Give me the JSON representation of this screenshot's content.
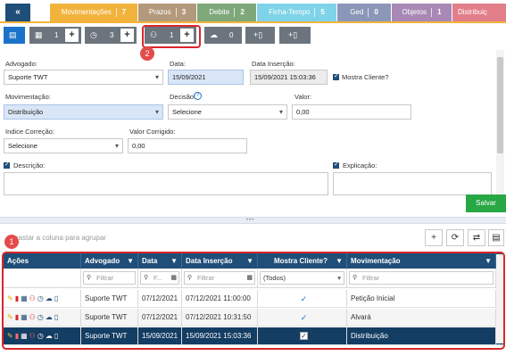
{
  "colors": {
    "accent": "#1f4e79",
    "active_blue": "#1a73c9",
    "save_green": "#28a745",
    "annotation_red": "#d9262c"
  },
  "tabs": [
    {
      "label": "Movimentações",
      "count": "7",
      "color": "#f2b33d"
    },
    {
      "label": "Prazos",
      "count": "3",
      "color": "#b39a7c"
    },
    {
      "label": "Debite",
      "count": "2",
      "color": "#7fa87a"
    },
    {
      "label": "Ficha-Tempo",
      "count": "5",
      "color": "#7fd3e8"
    },
    {
      "label": "Ged",
      "count": "0",
      "color": "#8b97b8"
    },
    {
      "label": "Objetos",
      "count": "1",
      "color": "#a888b5"
    },
    {
      "label": "Distribuiç",
      "count": "",
      "color": "#e37e8b"
    }
  ],
  "toolbar": {
    "calendar_count": "1",
    "clock_count": "3",
    "users_count": "1",
    "cloud_count": "0",
    "plus": "+"
  },
  "callouts": {
    "one": "1",
    "two": "2"
  },
  "form": {
    "advogado_label": "Advogado:",
    "advogado_value": "Suporte TWT",
    "data_label": "Data:",
    "data_value": "15/09/2021",
    "data_insercao_label": "Data Inserção:",
    "data_insercao_value": "15/09/2021 15:03:36",
    "mostra_cliente_label": "Mostra Cliente?",
    "movimentacao_label": "Movimentação:",
    "movimentacao_value": "Distribuição",
    "decisao_label": "Decisão:",
    "decisao_value": "Selecione",
    "valor_label": "Valor:",
    "valor_value": "0,00",
    "indice_label": "Indice Correção:",
    "indice_value": "Selecione",
    "valor_corrigido_label": "Valor Corrigido:",
    "valor_corrigido_value": "0,00",
    "descricao_label": "Descrição:",
    "explicacao_label": "Explicação:",
    "save_label": "Salvar"
  },
  "grid": {
    "group_hint": "Arrastar a coluna para agrupar",
    "columns": [
      "Ações",
      "Advogado",
      "Data",
      "Data Inserção",
      "Mostra Cliente?",
      "Movimentação"
    ],
    "filters": {
      "advogado_placeholder": "Filtrar",
      "data_placeholder": "F...",
      "data_insercao_placeholder": "Filtrar",
      "mostra_cliente_value": "(Todos)",
      "movimentacao_placeholder": "Filtrar"
    },
    "rows": [
      {
        "advogado": "Suporte TWT",
        "data": "07/12/2021",
        "data_insercao": "07/12/2021 11:00:00",
        "mostra_cliente": "✓",
        "movimentacao": "Petição Inicial"
      },
      {
        "advogado": "Suporte TWT",
        "data": "07/12/2021",
        "data_insercao": "07/12/2021 10:31:50",
        "mostra_cliente": "✓",
        "movimentacao": "Alvará"
      },
      {
        "advogado": "Suporte TWT",
        "data": "15/09/2021",
        "data_insercao": "15/09/2021 15:03:36",
        "mostra_cliente": "✓",
        "movimentacao": "Distribuição"
      }
    ]
  }
}
